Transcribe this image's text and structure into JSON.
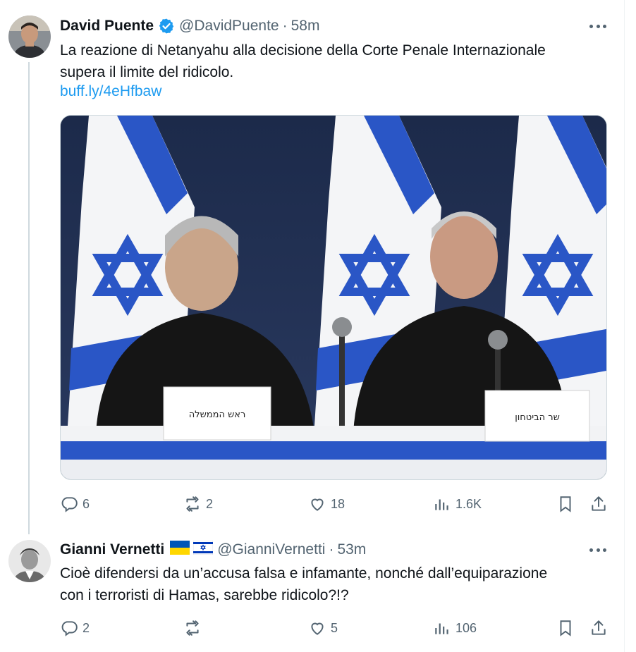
{
  "tweets": [
    {
      "author": "David Puente",
      "handle": "@DavidPuente",
      "separator": "·",
      "time": "58m",
      "text_line1": "La reazione di Netanyahu alla decisione della Corte Penale Internazionale",
      "text_line2": "supera il limite del ridicolo.",
      "link": "buff.ly/4eHfbaw",
      "verified": true,
      "media_signs": {
        "left": "ראש הממשלה",
        "right": "שר הביטחון"
      },
      "actions": {
        "replies": "6",
        "reposts": "2",
        "likes": "18",
        "views": "1.6K"
      }
    },
    {
      "author": "Gianni Vernetti",
      "handle": "@GianniVernetti",
      "separator": "·",
      "time": "53m",
      "text_line1": "Cioè difendersi da un’accusa falsa e infamante, nonché dall’equiparazione",
      "text_line2": "con i terroristi di Hamas, sarebbe ridicolo?!?",
      "flags": [
        "ukraine-flag",
        "israel-flag"
      ],
      "actions": {
        "replies": "2",
        "reposts": "",
        "likes": "5",
        "views": "106"
      }
    }
  ],
  "colors": {
    "text": "#0f1419",
    "secondary": "#536471",
    "link": "#1d9bf0",
    "verified": "#1d9bf0",
    "thread_line": "#cfd9de"
  }
}
